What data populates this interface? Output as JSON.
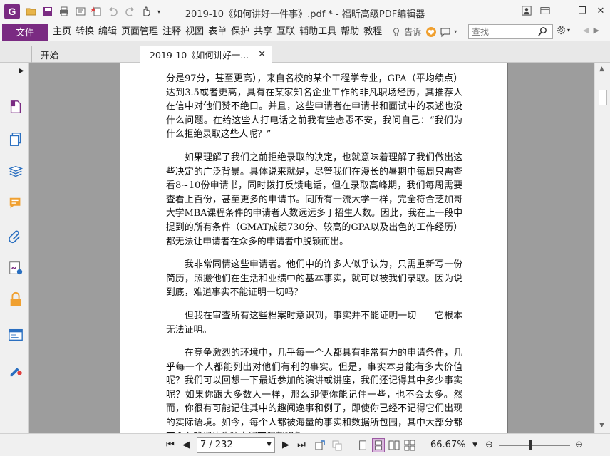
{
  "window": {
    "title": "2019-10《如何讲好一件事》.pdf * - 福昕高级PDF编辑器",
    "logo_letter": "G"
  },
  "menubar": {
    "file_label": "文件",
    "items": [
      "主页",
      "转换",
      "编辑",
      "页面管理",
      "注释",
      "视图",
      "表单",
      "保护",
      "共享",
      "互联",
      "辅助工具",
      "帮助",
      "教程"
    ],
    "tell_me": "告诉",
    "search_placeholder": "查找"
  },
  "tabs": [
    {
      "label": "开始"
    },
    {
      "label": "2019-10《如何讲好一..."
    }
  ],
  "document": {
    "paragraphs": [
      "分是97分，甚至更高），来自名校的某个工程学专业，GPA（平均绩点）达到3.5或者更高，具有在某家知名企业工作的非凡职场经历，其推荐人在信中对他们赞不绝口。并且，这些申请者在申请书和面试中的表述也没什么问题。在给这些人打电话之前我有些忐忑不安，我问自己：“我们为什么拒绝录取这些人呢？”",
      "如果理解了我们之前拒绝录取的决定，也就意味着理解了我们做出这些决定的广泛背景。具体说来就是，尽管我们在漫长的暑期中每周只需查看8~10份申请书，同时拨打反馈电话，但在录取高峰期，我们每周需要查看上百份，甚至更多的申请书。同所有一流大学一样，完全符合芝加哥大学MBA课程条件的申请者人数远远多于招生人数。因此，我在上一段中提到的所有条件（GMAT成绩730分、较高的GPA以及出色的工作经历）都无法让申请者在众多的申请者中脱颖而出。",
      "我非常同情这些申请者。他们中的许多人似乎认为，只需重新写一份简历，照搬他们在生活和业绩中的基本事实，就可以被我们录取。因为说到底，难道事实不能证明一切吗？",
      "但我在审查所有这些档案时意识到，事实并不能证明一切——它根本无法证明。",
      "在竞争激烈的环境中，几乎每一个人都具有非常有力的申请条件，几乎每一个人都能列出对他们有利的事实。但是，事实本身能有多大价值呢？我们可以回想一下最近参加的演讲或讲座，我们还记得其中多少事实呢？如果你跟大多数人一样，那么即使你能记住一些，也不会太多。然而，你很有可能记住其中的趣闻逸事和例子，即使你已经不记得它们出现的实际语境。如今，每个人都被海量的事实和数据所包围，其中大部分都不会在我们的头脑中留下深刻印象。"
    ]
  },
  "statusbar": {
    "page_value": "7 / 232",
    "zoom_value": "66.67%",
    "zoom_fraction": 0.45
  },
  "colors": {
    "brand": "#7a2b82",
    "doc_background": "#9d9d9d"
  }
}
